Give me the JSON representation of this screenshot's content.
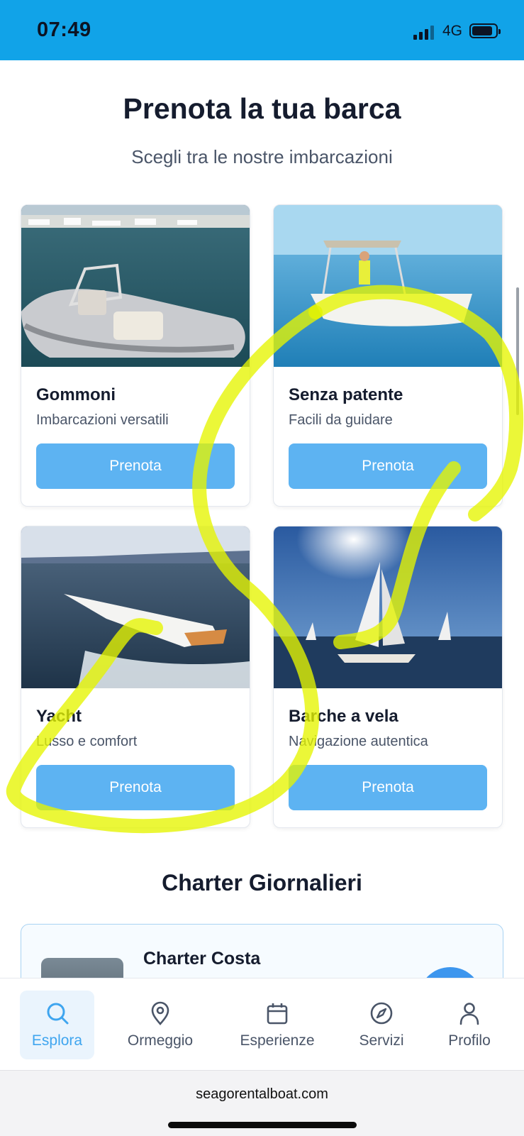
{
  "status_bar": {
    "time": "07:49",
    "network": "4G",
    "background": "#11a3e8"
  },
  "header": {
    "title": "Prenota la tua barca",
    "subtitle": "Scegli tra le nostre imbarcazioni"
  },
  "boat_categories": [
    {
      "name": "Gommoni",
      "description": "Imbarcazioni versatili",
      "button": "Prenota"
    },
    {
      "name": "Senza patente",
      "description": "Facili da guidare",
      "button": "Prenota"
    },
    {
      "name": "Yacht",
      "description": "Lusso e comfort",
      "button": "Prenota"
    },
    {
      "name": "Barche a vela",
      "description": "Navigazione autentica",
      "button": "Prenota"
    }
  ],
  "charter_section": {
    "title": "Charter Giornalieri",
    "items": [
      {
        "name": "Charter Costa"
      }
    ]
  },
  "tab_bar": {
    "items": [
      {
        "label": "Esplora",
        "icon": "search-icon",
        "active": true
      },
      {
        "label": "Ormeggio",
        "icon": "map-pin-icon",
        "active": false
      },
      {
        "label": "Esperienze",
        "icon": "calendar-icon",
        "active": false
      },
      {
        "label": "Servizi",
        "icon": "compass-icon",
        "active": false
      },
      {
        "label": "Profilo",
        "icon": "user-icon",
        "active": false
      }
    ]
  },
  "browser": {
    "url": "seagorentalboat.com"
  },
  "colors": {
    "accent": "#5db3f2",
    "active_tab": "#3fa5ef",
    "annotation": "#e6f500"
  }
}
